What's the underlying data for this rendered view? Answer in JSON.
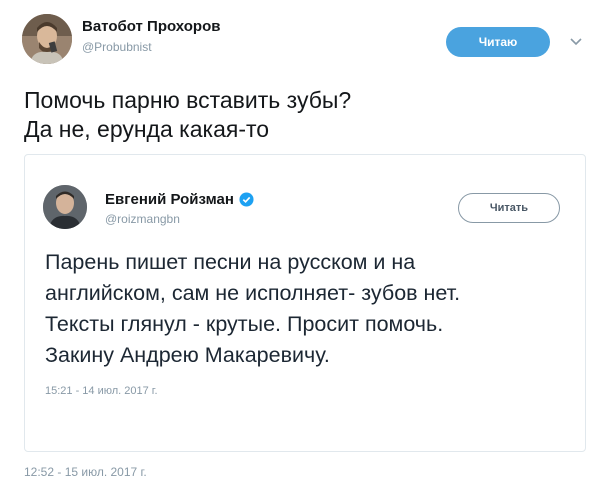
{
  "tweet": {
    "author_name": "Ватобот Прохоров",
    "author_handle": "@Probubnist",
    "follow_label": "Читаю",
    "text_lines": [
      "Помочь парню вставить зубы?",
      "Да не, ерунда какая-то"
    ],
    "timestamp": "12:52 - 15 июл. 2017 г."
  },
  "quoted": {
    "author_name": "Евгений Ройзман",
    "author_handle": "@roizmangbn",
    "verified": true,
    "follow_label": "Читать",
    "text_lines": [
      "Парень пишет песни на русском и на",
      "английском, сам не исполняет- зубов нет.",
      "Тексты глянул - крутые. Просит помочь.",
      "Закину Андрею Макаревичу."
    ],
    "timestamp": "15:21 - 14 июл. 2017 г."
  },
  "colors": {
    "accent": "#4aa3df",
    "verified": "#1da1f2",
    "muted": "#8899a6",
    "border": "#e1e8ed"
  },
  "icons": {
    "caret": "chevron-down-icon",
    "verified": "verified-badge-icon"
  }
}
